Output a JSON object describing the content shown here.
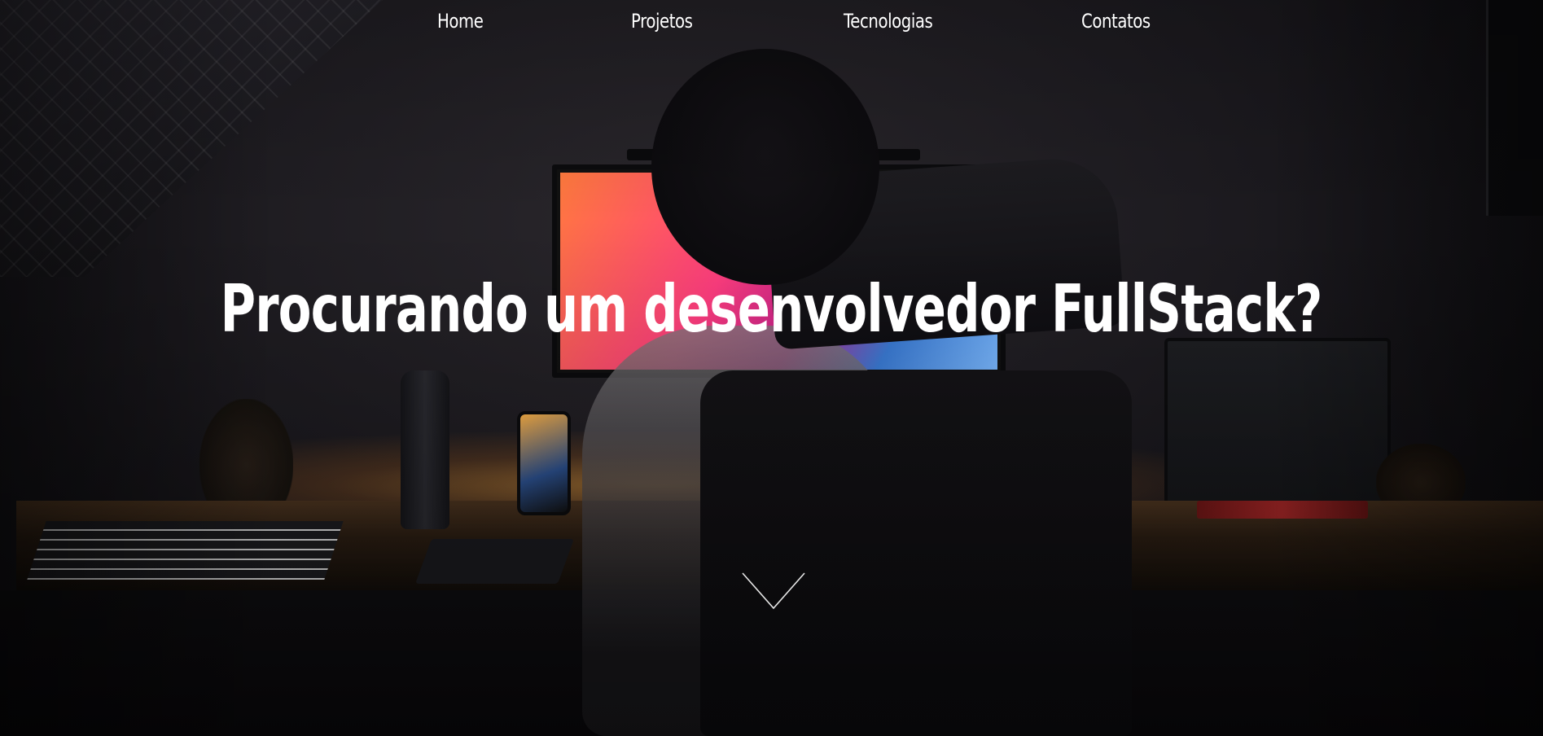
{
  "nav": {
    "items": [
      {
        "label": "Home"
      },
      {
        "label": "Projetos"
      },
      {
        "label": "Tecnologias"
      },
      {
        "label": "Contatos"
      }
    ]
  },
  "hero": {
    "headline": "Procurando um desenvolvedor FullStack?",
    "scroll_icon": "chevron-down-icon"
  },
  "colors": {
    "text": "#ffffff",
    "background": "#121115"
  }
}
